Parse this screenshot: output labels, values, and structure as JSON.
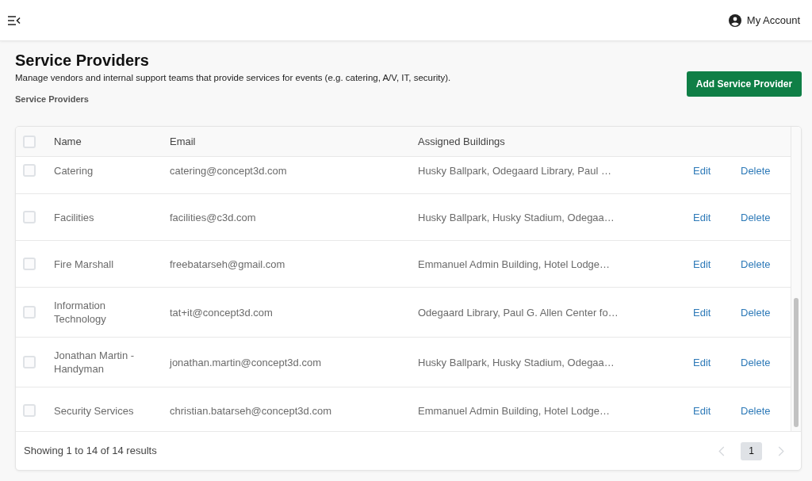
{
  "top_bar": {
    "account_label": "My Account"
  },
  "page_header": {
    "title": "Service Providers",
    "description": "Manage vendors and internal support teams that provide services for events (e.g. catering, A/V, IT, security).",
    "section_label": "Service Providers",
    "add_button": "Add Service Provider"
  },
  "table": {
    "select_all": {
      "checked": false
    },
    "columns": [
      "Name",
      "Email",
      "Assigned Buildings"
    ],
    "rows": [
      {
        "checked": false,
        "name": "Catering",
        "email": "catering@concept3d.com",
        "buildings": "Husky Ballpark, Odegaard Library, Paul …",
        "edit": "Edit",
        "delete": "Delete"
      },
      {
        "checked": false,
        "name": "Facilities",
        "email": "facilities@c3d.com",
        "buildings": "Husky Ballpark, Husky Stadium, Odegaa…",
        "edit": "Edit",
        "delete": "Delete"
      },
      {
        "checked": false,
        "name": "Fire Marshall",
        "email": "freebatarseh@gmail.com",
        "buildings": "Emmanuel Admin Building, Hotel Lodge…",
        "edit": "Edit",
        "delete": "Delete"
      },
      {
        "checked": false,
        "name": "Information Technology",
        "email": "tat+it@concept3d.com",
        "buildings": "Odegaard Library, Paul G. Allen Center fo…",
        "edit": "Edit",
        "delete": "Delete"
      },
      {
        "checked": false,
        "name": "Jonathan Martin - Handyman",
        "email": "jonathan.martin@concept3d.com",
        "buildings": "Husky Ballpark, Husky Stadium, Odegaa…",
        "edit": "Edit",
        "delete": "Delete"
      },
      {
        "checked": false,
        "name": "Security Services",
        "email": "christian.batarseh@concept3d.com",
        "buildings": "Emmanuel Admin Building, Hotel Lodge…",
        "edit": "Edit",
        "delete": "Delete"
      }
    ]
  },
  "footer": {
    "summary": "Showing 1 to 14 of 14 results",
    "pagination": {
      "previous": {
        "disabled": true
      },
      "pages": [
        {
          "label": "1",
          "selected": true
        }
      ],
      "next": {
        "disabled": true
      }
    }
  }
}
